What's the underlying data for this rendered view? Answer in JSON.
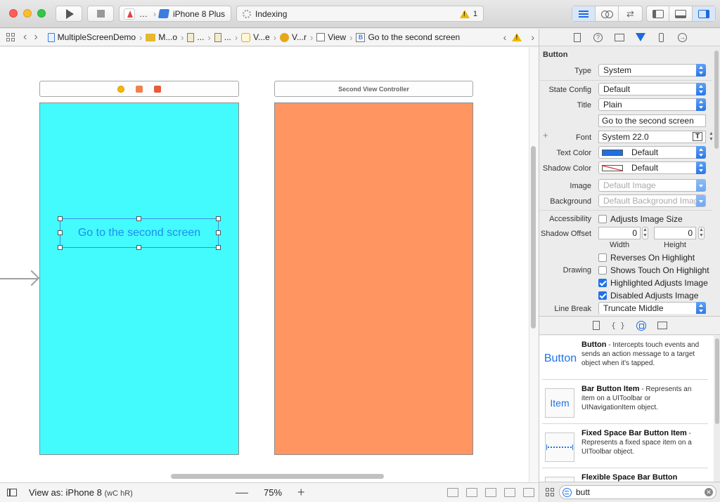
{
  "toolbar": {
    "scheme_name": "…",
    "device": "iPhone 8 Plus",
    "activity_status": "Indexing",
    "warning_count": "1"
  },
  "jumpbar": {
    "crumbs": [
      "MultipleScreenDemo",
      "M...o",
      "...",
      "...",
      "V...e",
      "V...r",
      "View",
      "Go to the second screen"
    ]
  },
  "canvas": {
    "scene2_title": "Second View Controller",
    "button_title": "Go to the second screen",
    "scene1_color": "#43fafd",
    "scene2_color": "#ff9561"
  },
  "bottombar": {
    "view_as_label": "View as: iPhone 8",
    "size_class": "(wC hR)",
    "zoom_minus": "—",
    "zoom_level": "75%",
    "zoom_plus": "+"
  },
  "inspector": {
    "section_title": "Button",
    "type_label": "Type",
    "type_value": "System",
    "state_config_label": "State Config",
    "state_config_value": "Default",
    "title_label": "Title",
    "title_value": "Plain",
    "title_text": "Go to the second screen",
    "font_label": "Font",
    "font_value": "System 22.0",
    "text_color_label": "Text Color",
    "text_color_value": "Default",
    "shadow_color_label": "Shadow Color",
    "shadow_color_value": "Default",
    "image_label": "Image",
    "image_placeholder": "Default Image",
    "background_label": "Background",
    "background_placeholder": "Default Background Imag",
    "accessibility_label": "Accessibility",
    "adjusts_image_size": "Adjusts Image Size",
    "shadow_offset_label": "Shadow Offset",
    "shadow_width": "0",
    "shadow_height": "0",
    "width_label": "Width",
    "height_label": "Height",
    "drawing_label": "Drawing",
    "reverses_on_highlight": "Reverses On Highlight",
    "shows_touch_on_highlight": "Shows Touch On Highlight",
    "highlighted_adjusts_image": "Highlighted Adjusts Image",
    "disabled_adjusts_image": "Disabled Adjusts Image",
    "line_break_label": "Line Break",
    "line_break_value": "Truncate Middle"
  },
  "library": {
    "items": [
      {
        "icon_text": "Button",
        "name": "Button",
        "desc": " - Intercepts touch events and sends an action message to a target object when it's tapped."
      },
      {
        "icon_text": "Item",
        "name": "Bar Button Item",
        "desc": " - Represents an item on a UIToolbar or UINavigationItem object."
      },
      {
        "icon_text": "",
        "name": "Fixed Space Bar Button Item",
        "desc": " - Represents a fixed space item on a UIToolbar object."
      },
      {
        "icon_text": "",
        "name": "Flexible Space Bar Button",
        "desc": ""
      }
    ],
    "filter_value": "butt"
  }
}
